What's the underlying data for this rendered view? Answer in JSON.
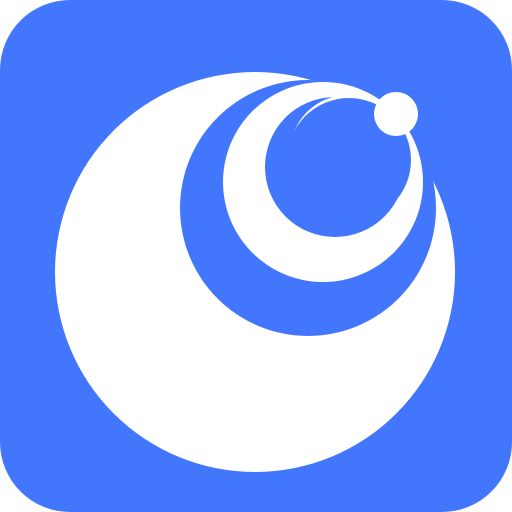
{
  "icon": {
    "name": "app-icon",
    "colors": {
      "background": "#4276FD",
      "foreground": "#FFFFFF"
    },
    "motif": "nested-crescent-orbit"
  }
}
